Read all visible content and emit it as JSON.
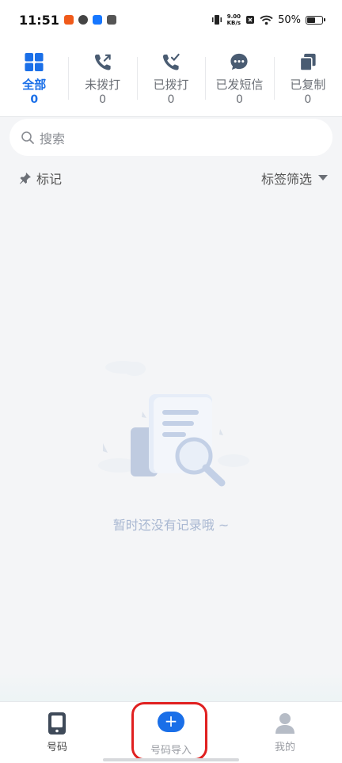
{
  "status_bar": {
    "time": "11:51",
    "net_speed_value": "9.00",
    "net_speed_unit": "KB/s",
    "battery": "50%"
  },
  "tabs": [
    {
      "label": "全部",
      "count": "0",
      "icon": "grid-icon",
      "active": true
    },
    {
      "label": "未拨打",
      "count": "0",
      "icon": "phone-outgoing-icon",
      "active": false
    },
    {
      "label": "已拨打",
      "count": "0",
      "icon": "phone-check-icon",
      "active": false
    },
    {
      "label": "已发短信",
      "count": "0",
      "icon": "message-icon",
      "active": false
    },
    {
      "label": "已复制",
      "count": "0",
      "icon": "copy-icon",
      "active": false
    }
  ],
  "search": {
    "placeholder": "搜索"
  },
  "filter": {
    "marks_label": "标记",
    "tag_filter_label": "标签筛选"
  },
  "empty": {
    "message": "暂时还没有记录哦 ~"
  },
  "bottom_nav": [
    {
      "label": "号码",
      "icon": "phone-device-icon"
    },
    {
      "label": "号码导入",
      "icon": "plus-icon",
      "glyph": "+"
    },
    {
      "label": "我的",
      "icon": "user-icon"
    }
  ],
  "colors": {
    "accent": "#1a6fe8",
    "highlight": "#e02020",
    "empty_text": "#a9b8d2"
  }
}
